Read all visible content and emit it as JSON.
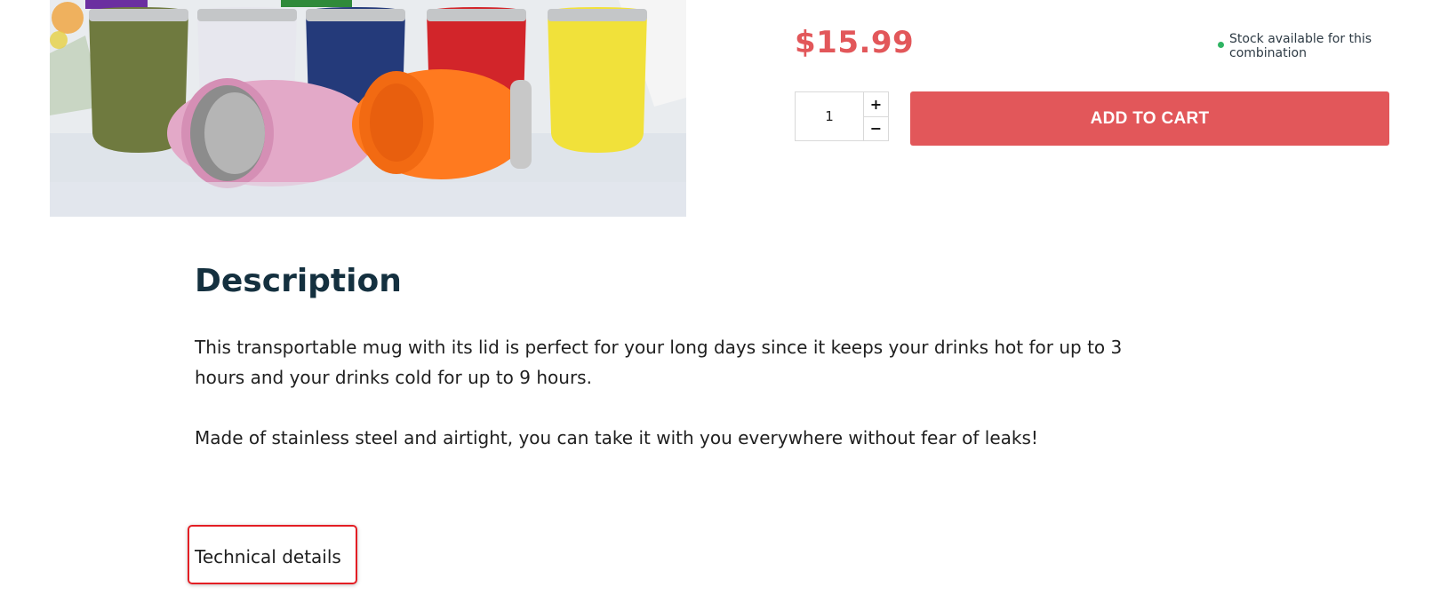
{
  "product": {
    "price": "$15.99",
    "stock_status": "Stock available for this combination",
    "stock_color": "#2fb463",
    "quantity": "1",
    "qty_increase": "+",
    "qty_decrease": "−",
    "add_to_cart": "ADD TO CART",
    "accent_color": "#e2575a"
  },
  "description": {
    "heading": "Description",
    "paragraphs": [
      "This transportable mug with its lid is perfect for your long days since it keeps your drinks hot for up to 3 hours and your drinks cold for up to 9 hours.",
      "Made of stainless steel and airtight, you can take it with you everywhere without fear of leaks!"
    ]
  },
  "tabs": {
    "technical_details": "Technical details"
  },
  "highlight_color": "#e31e24"
}
